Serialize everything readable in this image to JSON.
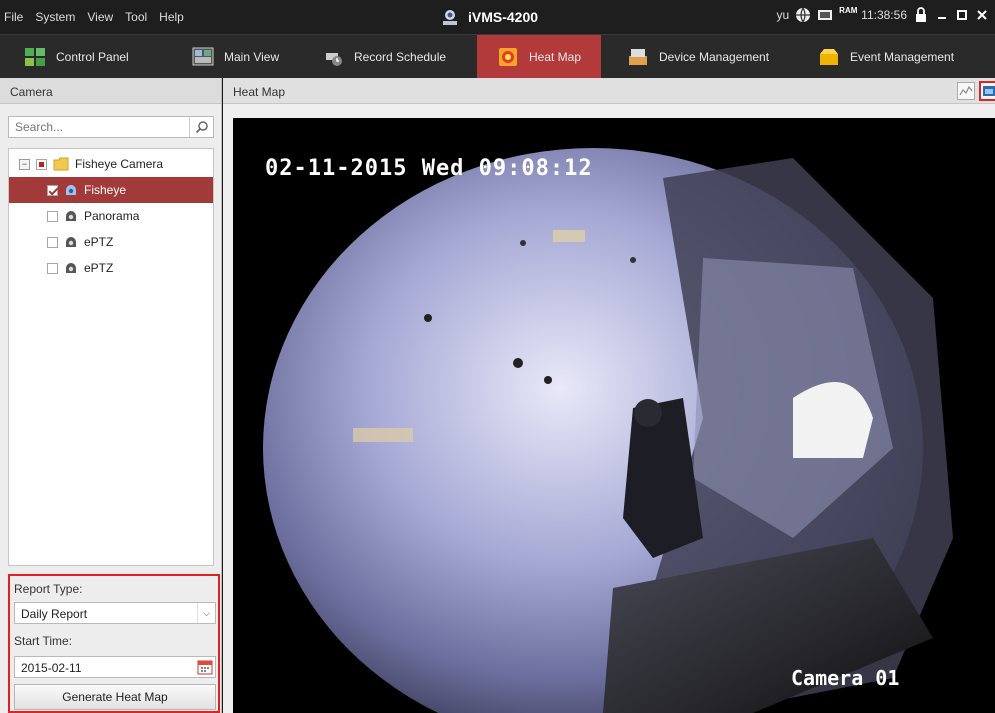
{
  "menu": {
    "items": [
      {
        "label": "File",
        "key": "F"
      },
      {
        "label": "System",
        "key": "S"
      },
      {
        "label": "View",
        "key": "V"
      },
      {
        "label": "Tool",
        "key": "T"
      },
      {
        "label": "Help",
        "key": "H"
      }
    ]
  },
  "app": {
    "title": "iVMS-4200"
  },
  "status": {
    "user": "yu",
    "ram_label": "RAM",
    "time": "11:38:56"
  },
  "tabs": [
    {
      "label": "Control Panel",
      "icon": "control-panel-icon"
    },
    {
      "label": "Main View",
      "icon": "main-view-icon"
    },
    {
      "label": "Record Schedule",
      "icon": "record-schedule-icon"
    },
    {
      "label": "Heat Map",
      "icon": "heat-map-icon",
      "active": true
    },
    {
      "label": "Device Management",
      "icon": "device-management-icon"
    },
    {
      "label": "Event Management",
      "icon": "event-management-icon"
    }
  ],
  "left": {
    "header": "Camera",
    "search_placeholder": "Search...",
    "tree": [
      {
        "label": "Fisheye Camera",
        "level": 0,
        "checked": "partial",
        "icon": "folder-icon"
      },
      {
        "label": "Fisheye",
        "level": 1,
        "checked": true,
        "selected": true,
        "icon": "camera-icon"
      },
      {
        "label": "Panorama",
        "level": 1,
        "checked": false,
        "icon": "camera-icon"
      },
      {
        "label": "ePTZ",
        "level": 1,
        "checked": false,
        "icon": "camera-icon"
      },
      {
        "label": "ePTZ",
        "level": 1,
        "checked": false,
        "icon": "camera-icon"
      }
    ],
    "report": {
      "type_label": "Report Type:",
      "type_value": "Daily Report",
      "start_label": "Start Time:",
      "start_value": "2015-02-11",
      "generate_label": "Generate Heat Map"
    }
  },
  "right": {
    "header": "Heat Map",
    "video": {
      "timestamp": "02-11-2015 Wed 09:08:12",
      "camera_label": "Camera 01"
    }
  },
  "colors": {
    "accent": "#b33a3a",
    "highlight_border": "#dd2222"
  }
}
